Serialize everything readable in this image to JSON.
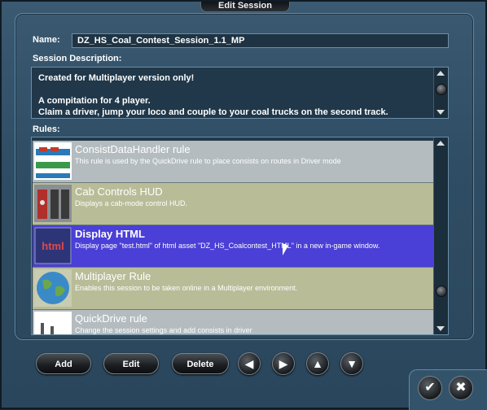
{
  "window": {
    "title": "Edit Session"
  },
  "name": {
    "label": "Name:",
    "value": "DZ_HS_Coal_Contest_Session_1.1_MP"
  },
  "description": {
    "label": "Session Description:",
    "text": "Created for Multiplayer version only!\n\nA compitation for 4 player.\nClaim a driver, jump your loco and couple to your coal trucks on the second track."
  },
  "rules": {
    "label": "Rules:",
    "items": [
      {
        "name": "ConsistDataHandler rule",
        "description": "This rule is used by the QuickDrive rule to place consists on routes in Driver mode",
        "icon": "train-icon",
        "style": "gray"
      },
      {
        "name": "Cab Controls HUD",
        "description": "Displays a cab-mode control HUD.",
        "icon": "cab-controls-icon",
        "style": "olive"
      },
      {
        "name": "Display HTML",
        "description": "Display page \"test.html\" of html asset \"DZ_HS_Coalcontest_HTML\" in a new in-game window.",
        "icon": "html-icon",
        "style": "selected"
      },
      {
        "name": "Multiplayer Rule",
        "description": "Enables this session to be taken online in a Multiplayer environment.",
        "icon": "globe-icon",
        "style": "olive"
      },
      {
        "name": "QuickDrive rule",
        "description": "Change the session settings and add consists in driver",
        "icon": "quickdrive-icon",
        "style": "gray"
      }
    ]
  },
  "buttons": {
    "add": "Add",
    "edit": "Edit",
    "delete": "Delete"
  },
  "colors": {
    "selected_row": "#4a3fd6",
    "gray_row": "#b4bcc0",
    "olive_row": "#b8bd98",
    "frame": "#2f4d64"
  }
}
